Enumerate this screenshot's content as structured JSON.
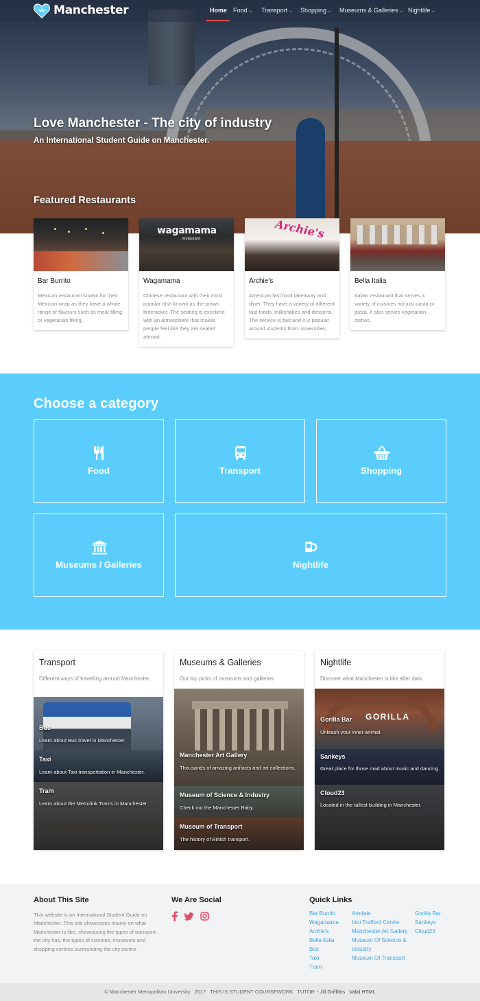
{
  "nav": {
    "logo_text": "Manchester",
    "items": [
      {
        "label": "Home"
      },
      {
        "label": "Food"
      },
      {
        "label": "Transport"
      },
      {
        "label": "Shopping"
      },
      {
        "label": "Museums & Galleries"
      },
      {
        "label": "Nightlife"
      }
    ]
  },
  "hero": {
    "title": "Love Manchester - The city of industry",
    "subtitle": "An International Student Guide on Manchester."
  },
  "featured": {
    "heading": "Featured Restaurants",
    "cards": [
      {
        "name": "Bar Burrito",
        "desc": "Mexican restaurant known for their Mexican wrap as they have a whole range of flavours such as meat filling or vegetarian filling."
      },
      {
        "name": "Wagamama",
        "desc": "Chinese restaurant with their most popular dish known as the prawn firecracker. The seating is excellent with an atmosphere that makes people feel like they are seated abroad.",
        "sign": "wagamama",
        "sign_sub": "restaurant"
      },
      {
        "name": "Archie's",
        "desc": "American fast food takeaway and diner. They have a variety of different fast foods, milkshakes and desserts. The service is fast and it is popular around students from universities.",
        "sign": "Archie's"
      },
      {
        "name": "Bella Italia",
        "desc": "Italian restaurant that serves a variety of cuisines not just pasta or pizza. It also serves vegetarian dishes."
      }
    ]
  },
  "category": {
    "heading": "Choose a category",
    "tiles": [
      {
        "label": "Food",
        "icon": "cutlery-icon"
      },
      {
        "label": "Transport",
        "icon": "bus-icon"
      },
      {
        "label": "Shopping",
        "icon": "basket-icon"
      },
      {
        "label": "Museums / Galleries",
        "icon": "museum-icon"
      },
      {
        "label": "Nightlife",
        "icon": "cocktail-icon"
      }
    ]
  },
  "features": [
    {
      "title": "Transport",
      "desc": "Different ways of travelling around Manchester.",
      "items": [
        {
          "title": "Bus",
          "desc": "Learn about Bus travel in Manchester."
        },
        {
          "title": "Taxi",
          "desc": "Learn about Taxi transportation in Manchester."
        },
        {
          "title": "Tram",
          "desc": "Learn about the Metrolink Trams in Manchester."
        }
      ]
    },
    {
      "title": "Museums & Galleries",
      "desc": "Our top picks of museums and galleries.",
      "items": [
        {
          "title": "Manchester Art Gallery",
          "desc": "Thousands of amazing artifacts and art collections."
        },
        {
          "title": "Museum of Science & Industry",
          "desc": "Check out the Manchester Baby."
        },
        {
          "title": "Museum of Transport",
          "desc": "The history of British transport."
        }
      ]
    },
    {
      "title": "Nightlife",
      "desc": "Discover what Manchester is like after dark.",
      "sign": "GORILLA",
      "items": [
        {
          "title": "Gorilla Bar",
          "desc": "Unleash your inner animal."
        },
        {
          "title": "Sankeys",
          "desc": "Great place for those mad about music and dancing."
        },
        {
          "title": "Cloud23",
          "desc": "Located in the tallest building in Manchester."
        }
      ]
    }
  ],
  "footer": {
    "about_heading": "About This Site",
    "about_text": "This website is an International Student Guide on Manchester. This site showcases mainly on what Manchester is like, showcasing the types of transport the city has, the types of cuisines, museums and shopping centres surrounding the city centre.",
    "social_heading": "We Are Social",
    "social": [
      "facebook-icon",
      "twitter-icon",
      "instagram-icon"
    ],
    "quick_heading": "Quick Links",
    "links_col1": [
      "Bar Burrito",
      "Wagamama",
      "Archie's",
      "Bella italia",
      "Bus",
      "Taxi",
      "Tram"
    ],
    "links_col2": [
      "Arndale",
      "Intu Trafford Centre",
      "Manchester Art Gallery",
      "Museum Of Science &",
      "Industry",
      "Museum Of Transport"
    ],
    "links_col3": [
      "Gorilla Bar",
      "Sankeys",
      "Cloud23"
    ]
  },
  "copyright": {
    "text": "© Manchester Metropolitan University",
    "year": "2017",
    "note": "THIS IS STUDENT COURSEWORK",
    "tutor_label": "TUTOR",
    "tutor": "- Jill Griffiths",
    "valid": "Valid HTML"
  },
  "colors": {
    "category_bg": "#5bcdfc",
    "link": "#3aa5e8",
    "social": "#e74c6a",
    "nav_active": "#e24a4a"
  }
}
